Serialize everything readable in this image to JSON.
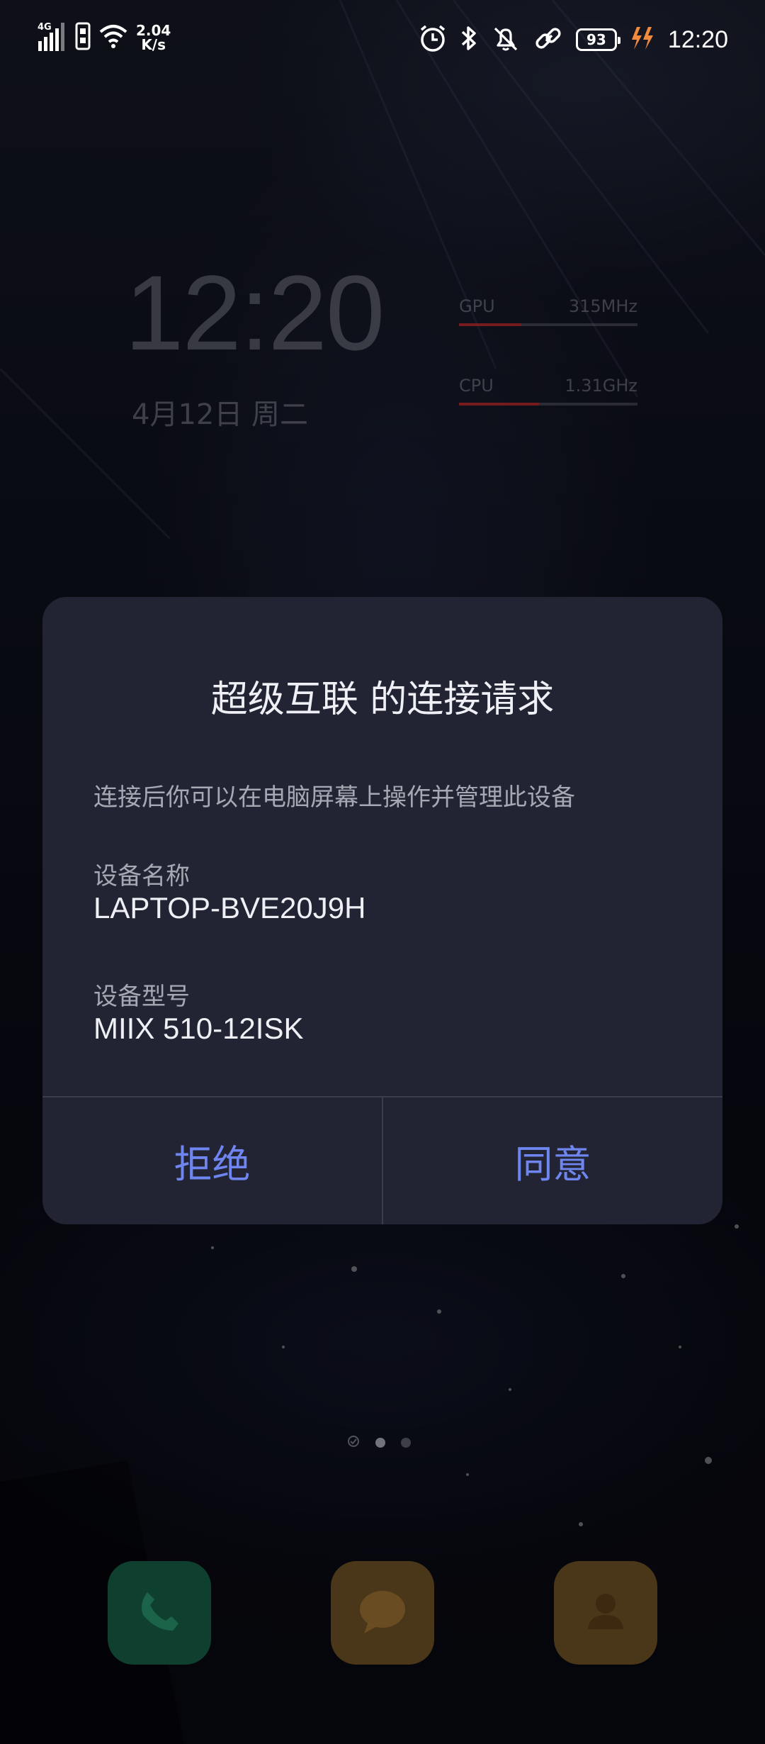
{
  "status_bar": {
    "network": "4G",
    "speed_value": "2.04",
    "speed_unit": "K/s",
    "battery": "93",
    "time": "12:20"
  },
  "lock_widget": {
    "time": "12:20",
    "date": "4月12日 周二",
    "gpu_label": "GPU",
    "gpu_value": "315MHz",
    "gpu_level": 0.35,
    "cpu_label": "CPU",
    "cpu_value": "1.31GHz",
    "cpu_level": 0.45
  },
  "dialog": {
    "title": "超级互联 的连接请求",
    "description": "连接后你可以在电脑屏幕上操作并管理此设备",
    "device_name_label": "设备名称",
    "device_name": "LAPTOP-BVE20J9H",
    "device_model_label": "设备型号",
    "device_model": "MIIX 510-12ISK",
    "reject_label": "拒绝",
    "accept_label": "同意",
    "accent_color": "#6f86f0"
  },
  "icons": {
    "status": [
      "signal-icon",
      "sim-icon",
      "wifi-icon",
      "alarm-icon",
      "bluetooth-icon",
      "mute-icon",
      "link-icon",
      "battery-icon",
      "charging-icon"
    ],
    "dock": [
      "phone-icon",
      "messages-icon",
      "contacts-icon"
    ]
  }
}
